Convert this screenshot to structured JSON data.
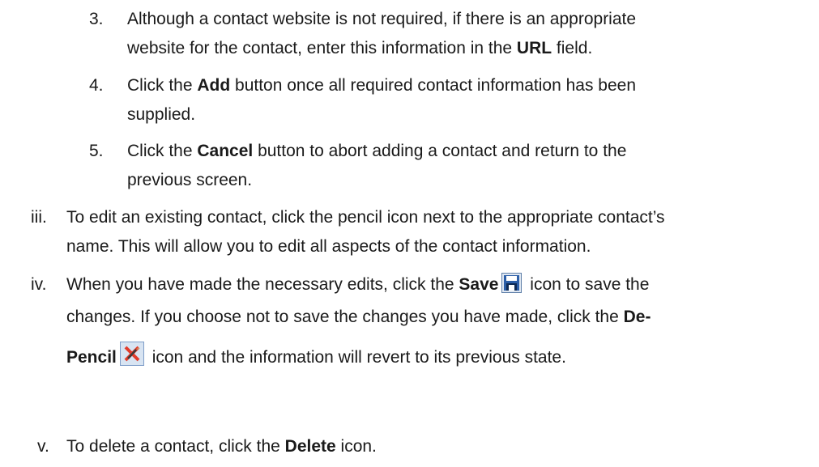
{
  "steps": [
    {
      "marker": "3.",
      "line1": "Although a contact website is not required, if there is an appropriate",
      "line2_pre": "website for the contact, enter this information in the ",
      "line2_bold": "URL",
      "line2_post": " field."
    },
    {
      "marker": "4.",
      "line1_pre": "Click the ",
      "line1_bold": "Add",
      "line1_post": " button once all required contact information has been",
      "line2": "supplied."
    },
    {
      "marker": "5.",
      "line1_pre": "Click the ",
      "line1_bold": "Cancel",
      "line1_post": " button to abort adding a contact and return to the",
      "line2": "previous screen."
    }
  ],
  "items": [
    {
      "marker": "iii.",
      "line1": "To edit an existing contact, click the pencil icon next to the appropriate contact’s",
      "line2": "name. This will allow you to edit all aspects of the contact information."
    },
    {
      "marker": "iv.",
      "line1_pre": "When you have made the necessary edits, click the ",
      "line1_bold": "Save",
      "line1_post": " icon to save the",
      "line2_pre": "changes. If you choose not to save the changes you have made, click the ",
      "line2_bold": "De-",
      "line3_bold": "Pencil",
      "line3_post": " icon and the information will revert to its previous state.",
      "save_icon": "floppy-disk-save-icon",
      "depencil_icon": "de-pencil-icon"
    },
    {
      "marker": "v.",
      "line1_pre": "To delete a contact, click the ",
      "line1_bold": "Delete",
      "line1_post": " icon."
    }
  ]
}
